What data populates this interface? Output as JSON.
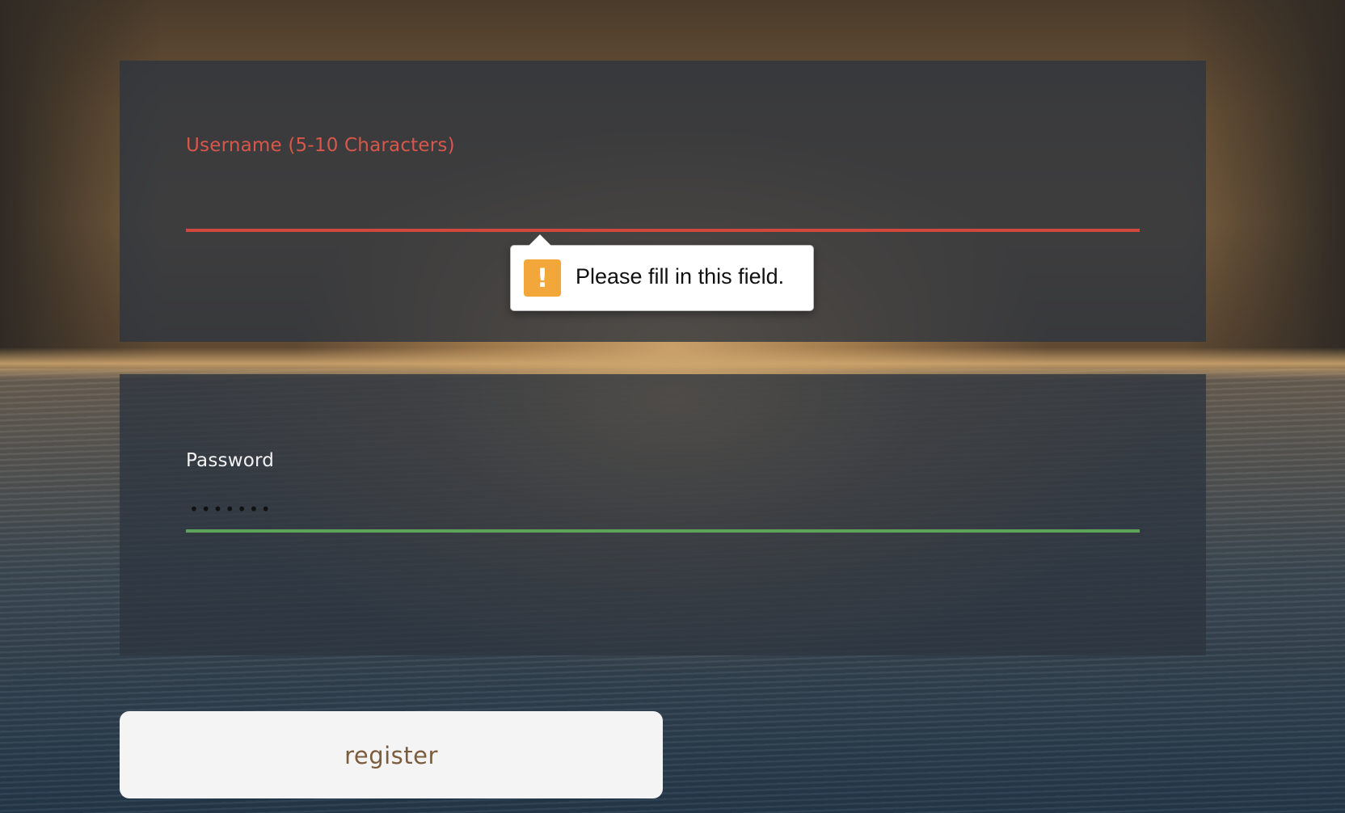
{
  "form": {
    "username": {
      "label": "Username (5-10 Characters)",
      "value": "",
      "validation_message": "Please fill in this field."
    },
    "password": {
      "label": "Password",
      "value": "•••••••"
    },
    "register_label": "register"
  },
  "icons": {
    "warning": "!"
  },
  "colors": {
    "error": "#d0473c",
    "valid": "#5ea35a",
    "warning_icon": "#f3a73b",
    "button_text": "#7b5c3d"
  }
}
